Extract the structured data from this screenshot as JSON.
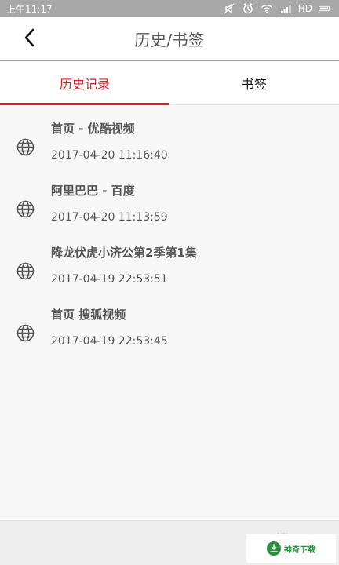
{
  "status_bar": {
    "time": "上午11:17",
    "network_label": "HD"
  },
  "header": {
    "title": "历史/书签"
  },
  "tabs": [
    {
      "label": "历史记录",
      "active": true
    },
    {
      "label": "书签",
      "active": false
    }
  ],
  "history": {
    "items": [
      {
        "title": "首页 - 优酷视频",
        "time": "2017-04-20 11:16:40",
        "icon": "globe-icon"
      },
      {
        "title": "阿里巴巴 - 百度",
        "time": "2017-04-20 11:13:59",
        "icon": "globe-icon"
      },
      {
        "title": "降龙伏虎小济公第2季第1集",
        "time": "2017-04-19 22:53:51",
        "icon": "globe-icon"
      },
      {
        "title": "首页 搜狐视频",
        "time": "2017-04-19 22:53:45",
        "icon": "globe-icon"
      }
    ]
  },
  "footer": {
    "clear_label": "清"
  },
  "watermark": {
    "text": "神奇下载"
  },
  "colors": {
    "accent": "#d71f25",
    "status_bar": "#a8a8a8",
    "background": "#f7f7f7",
    "text": "#555555"
  }
}
